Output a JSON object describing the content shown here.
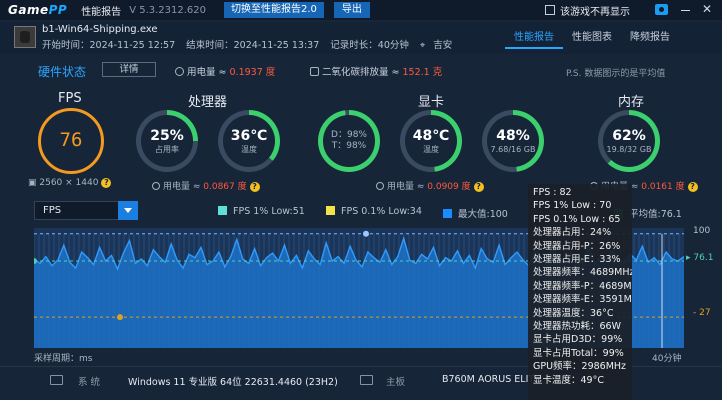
{
  "app": {
    "logo_main": "Game",
    "logo_accent": "PP",
    "title": "性能报告",
    "version": "V 5.3.2312.620",
    "switch_button": "切换至性能报告2.0",
    "export_button": "导出",
    "dont_show_again": "该游戏不再显示",
    "close": "✕"
  },
  "session": {
    "exe": "b1-Win64-Shipping.exe",
    "start": "开始时间：2024-11-25 12:57",
    "end": "结束时间：2024-11-25 13:37",
    "duration": "记录时长：40分钟",
    "location": "吉安"
  },
  "tabs": [
    {
      "label": "性能报告",
      "active": true
    },
    {
      "label": "性能图表",
      "active": false
    },
    {
      "label": "降频报告",
      "active": false
    }
  ],
  "hardware": {
    "title": "硬件状态",
    "detail_button": "详情",
    "power_label": "用电量 ≈ ",
    "power_value": "0.1937 度",
    "co2_label": "二氧化碳排放量 ≈ ",
    "co2_value": "152.1 克",
    "note": "P.S. 数据图示的是平均值"
  },
  "fps": {
    "label": "FPS",
    "value": "76",
    "resolution": "2560 × 1440",
    "help": "?"
  },
  "cpu": {
    "label": "处理器",
    "usage_value": "25%",
    "usage_label": "占用率",
    "usage_pct": 25,
    "temp_value": "36℃",
    "temp_label": "温度",
    "temp_pct": 36,
    "power_label": "用电量 ≈ ",
    "power_value": "0.0867 度",
    "help": "?"
  },
  "gpu": {
    "label": "显卡",
    "d_line": "D：98%",
    "t_line": "T：98%",
    "d_pct": 98,
    "temp_value": "48℃",
    "temp_label": "温度",
    "temp_pct": 48,
    "mem_value": "48%",
    "mem_label": "7.68/16 GB",
    "mem_pct": 48,
    "power_label": "用电量 ≈ ",
    "power_value": "0.0909 度",
    "help": "?"
  },
  "ram": {
    "label": "内存",
    "value": "62%",
    "detail": "19.8/32 GB",
    "pct": 62,
    "power_label": "用电量 ≈ ",
    "power_value": "0.0161 度",
    "help": "?"
  },
  "chart_controls": {
    "selected_metric": "FPS",
    "legend": [
      {
        "label": "FPS 1% Low:51",
        "color": "#5fe0d6"
      },
      {
        "label": "FPS 0.1% Low:34",
        "color": "#f3e34a"
      },
      {
        "label": "最大值:100",
        "color": "#1a8cff"
      },
      {
        "label": "平均值:76.1",
        "color": "#2f7d3a"
      }
    ]
  },
  "chart_data": {
    "type": "area",
    "metric": "FPS",
    "max": 100,
    "average": 76.1,
    "low_1pct": 51,
    "low_01pct": 34,
    "y_axis_labels": [
      "100",
      "76.1",
      "27"
    ],
    "duration_label": "40分钟",
    "sample_label": "采样周期：ms",
    "series": [
      78,
      74,
      80,
      72,
      77,
      90,
      75,
      70,
      84,
      79,
      73,
      88,
      76,
      81,
      69,
      83,
      94,
      74,
      78,
      72,
      86,
      80,
      75,
      91,
      77,
      70,
      82,
      79,
      88,
      73,
      76,
      84,
      71,
      80,
      95,
      78,
      74,
      87,
      72,
      79,
      83,
      76,
      90,
      74,
      81,
      70,
      85,
      78,
      73,
      92,
      76,
      80,
      74,
      89,
      77,
      71,
      84,
      79,
      75,
      86,
      73,
      80,
      96,
      77,
      74,
      82,
      78,
      88,
      72,
      79,
      76,
      85,
      74,
      81,
      70,
      87,
      78,
      75,
      90,
      73,
      79,
      84,
      77,
      72,
      86,
      80,
      76,
      91,
      74,
      78,
      83,
      79,
      75,
      88,
      73,
      80,
      76,
      85,
      78,
      74,
      82,
      77,
      89,
      75,
      79,
      73,
      84,
      78,
      76,
      80
    ]
  },
  "tooltip": [
    "FPS : 82",
    "FPS 1% Low : 70",
    "FPS 0.1% Low : 65",
    "处理器占用：24%",
    "处理器占用-P：26%",
    "处理器占用-E：33%",
    "处理器频率：4689MHz",
    "处理器频率-P：4689MHz",
    "处理器频率-E：3591MHz",
    "处理器温度：36°C",
    "处理器热功耗：66W",
    "显卡占用D3D：99%",
    "显卡占用Total：99%",
    "GPU频率：2986MHz",
    "显卡温度：49°C"
  ],
  "system": {
    "os_key": "系 统",
    "os_value": "Windows 11 专业版 64位 22631.4460 (23H2)",
    "board_key": "主板",
    "board_value": "B760M AORUS ELITE"
  }
}
